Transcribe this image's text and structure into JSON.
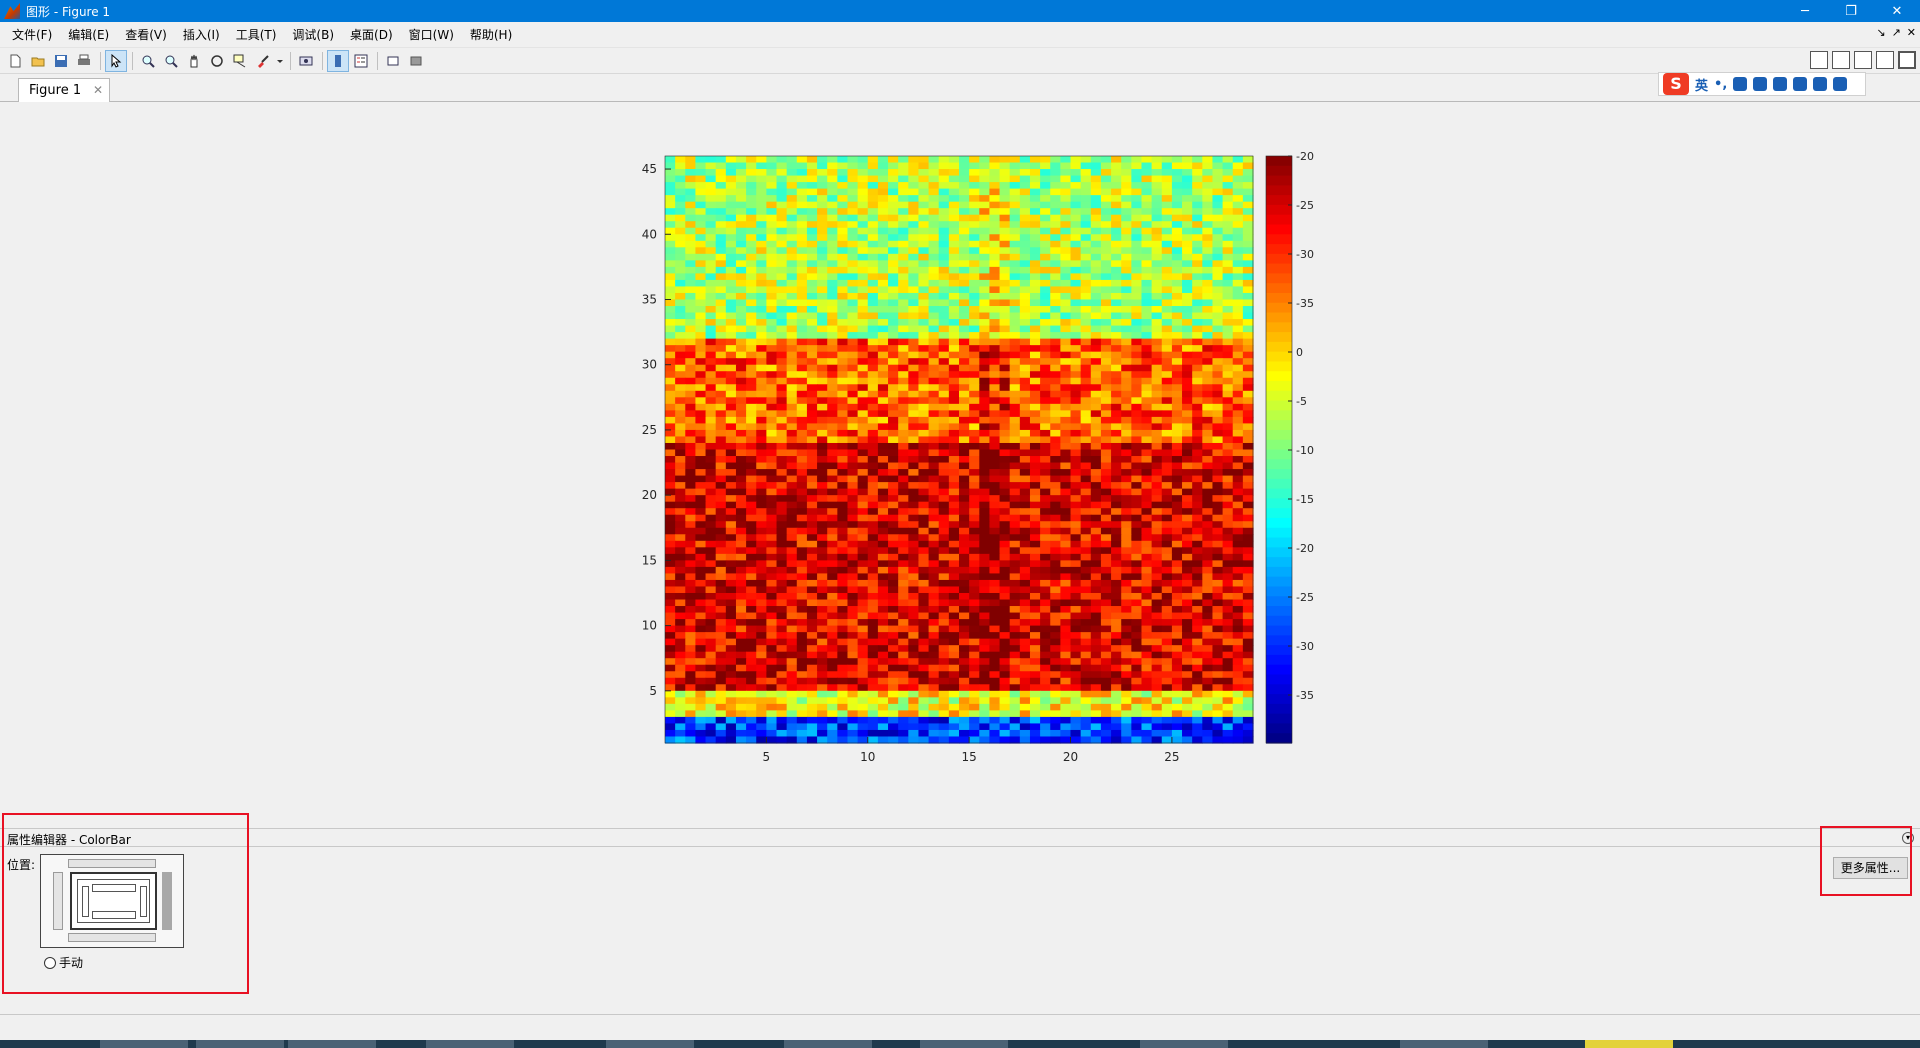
{
  "window": {
    "title": "图形 - Figure 1",
    "minimize": "─",
    "restore": "❐",
    "close": "✕"
  },
  "menu": {
    "items": [
      "文件(F)",
      "编辑(E)",
      "查看(V)",
      "插入(I)",
      "工具(T)",
      "调试(B)",
      "桌面(D)",
      "窗口(W)",
      "帮助(H)"
    ],
    "dock_controls": [
      "↘",
      "↗",
      "✕"
    ]
  },
  "toolbar": {
    "icons": [
      "new-figure-icon",
      "open-file-icon",
      "save-icon",
      "print-icon",
      "edit-plot-icon",
      "zoom-in-icon",
      "zoom-out-icon",
      "pan-icon",
      "rotate-3d-icon",
      "data-cursor-icon",
      "brush-icon",
      "link-plot-icon",
      "insert-colorbar-icon",
      "insert-legend-icon",
      "hide-plot-tools-icon",
      "show-plot-tools-icon"
    ],
    "layout_icons": [
      "tile-icon",
      "left-right-icon",
      "top-bottom-icon",
      "float-icon",
      "maximize-icon"
    ]
  },
  "tabs": {
    "figure_tab": "Figure 1",
    "close": "✕"
  },
  "ime": {
    "logo": "S",
    "lang": "英",
    "punct": "•,"
  },
  "chart_data": {
    "type": "heatmap",
    "colormap": "jet",
    "x_ticks": [
      5,
      10,
      15,
      20,
      25
    ],
    "y_ticks": [
      5,
      10,
      15,
      20,
      25,
      30,
      35,
      40,
      45
    ],
    "xlim": [
      0,
      29
    ],
    "ylim": [
      1,
      46
    ],
    "colorbar_ticks": [
      "-20",
      "-25",
      "-30",
      "-35",
      "0",
      "-5",
      "-10",
      "-15",
      "-20",
      "-25",
      "-30",
      "-35"
    ],
    "region_levels": [
      {
        "y_from": 1,
        "y_to": 3,
        "level": 0.18
      },
      {
        "y_from": 3,
        "y_to": 5,
        "level": 0.62
      },
      {
        "y_from": 5,
        "y_to": 24,
        "level": 0.9
      },
      {
        "y_from": 24,
        "y_to": 32,
        "level": 0.78
      },
      {
        "y_from": 32,
        "y_to": 46,
        "level": 0.55
      }
    ]
  },
  "property_editor": {
    "title": "属性编辑器 - ColorBar",
    "position_label": "位置:",
    "manual_label": "手动",
    "more_button": "更多属性...",
    "collapse": "▾"
  },
  "colors": {
    "titlebar": "#0078d7",
    "highlight_box": "#e81123"
  }
}
